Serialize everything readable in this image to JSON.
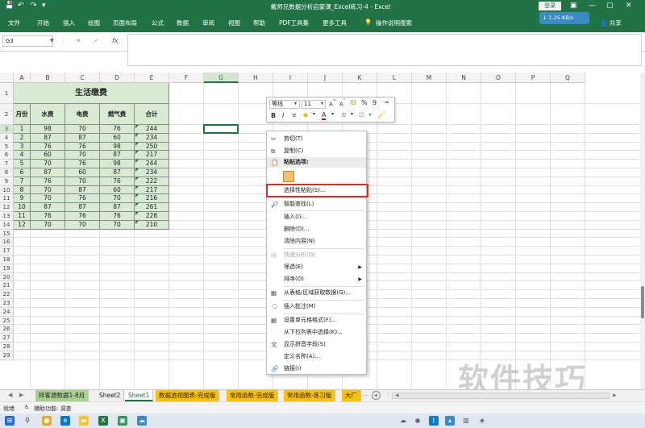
{
  "window": {
    "title": "戴师兄数据分析启蒙课_Excel练习-4  -  Excel",
    "login": "登录",
    "minimize": "—",
    "restore": "▢",
    "close": "✕"
  },
  "ribbon": {
    "tabs": [
      "文件",
      "开始",
      "插入",
      "绘图",
      "页面布局",
      "公式",
      "数据",
      "审阅",
      "视图",
      "帮助",
      "PDF工具集",
      "更多工具",
      "操作说明搜索"
    ],
    "share": "共享",
    "net_speed": "↓ 1.25 KB/s"
  },
  "formula_bar": {
    "name_box": "G3",
    "cancel": "✕",
    "enter": "✓",
    "fx": "fx",
    "value": ""
  },
  "columns": [
    "A",
    "B",
    "C",
    "D",
    "E",
    "F",
    "G",
    "H",
    "I",
    "J",
    "K",
    "L",
    "M",
    "N",
    "O",
    "P",
    "Q"
  ],
  "rows": [
    "1",
    "2",
    "3",
    "4",
    "5",
    "6",
    "7",
    "8",
    "9",
    "10",
    "11",
    "12",
    "13",
    "14",
    "15",
    "16",
    "17",
    "18",
    "19",
    "20",
    "21",
    "22",
    "23",
    "24",
    "25",
    "26",
    "27",
    "28",
    "29"
  ],
  "table": {
    "title": "生活缴费",
    "headers": [
      "月份",
      "水费",
      "电费",
      "燃气费",
      "合计"
    ],
    "data": [
      [
        "1",
        "98",
        "70",
        "76",
        "244"
      ],
      [
        "2",
        "87",
        "87",
        "60",
        "234"
      ],
      [
        "3",
        "76",
        "76",
        "98",
        "250"
      ],
      [
        "4",
        "60",
        "70",
        "87",
        "217"
      ],
      [
        "5",
        "70",
        "76",
        "98",
        "244"
      ],
      [
        "6",
        "87",
        "60",
        "87",
        "234"
      ],
      [
        "7",
        "76",
        "70",
        "76",
        "222"
      ],
      [
        "8",
        "70",
        "87",
        "60",
        "217"
      ],
      [
        "9",
        "70",
        "76",
        "70",
        "216"
      ],
      [
        "10",
        "87",
        "87",
        "87",
        "261"
      ],
      [
        "11",
        "76",
        "76",
        "76",
        "228"
      ],
      [
        "12",
        "70",
        "70",
        "70",
        "210"
      ]
    ]
  },
  "mini_toolbar": {
    "font": "等线",
    "size": "11",
    "bold": "B",
    "italic": "I",
    "percent": "%",
    "comma": "9"
  },
  "context_menu": {
    "cut": "剪切(T)",
    "copy": "复制(C)",
    "paste_options": "粘贴选项:",
    "paste_special": "选择性粘贴(S)...",
    "smart_lookup": "智能查找(L)",
    "insert": "插入(I)...",
    "delete": "删除(D)...",
    "clear": "清除内容(N)",
    "quick_analysis": "快速分析(Q)",
    "filter": "筛选(E)",
    "sort": "排序(O)",
    "from_table": "从表格/区域获取数据(G)...",
    "insert_comment": "插入批注(M)",
    "format_cells": "设置单元格格式(F)...",
    "pick_list": "从下拉列表中选择(K)...",
    "phonetic": "显示拼音字段(S)",
    "define_name": "定义名称(A)...",
    "link": "链接(I)"
  },
  "sheet_tabs": {
    "tabs": [
      "拌客源数据1-8月",
      "Sheet2",
      "Sheet1",
      "数据透视图表-完成版",
      "常用函数-完成版",
      "常用函数-练习版",
      "大厂"
    ],
    "active": "Sheet1",
    "add": "+"
  },
  "status": {
    "ready": "就绪",
    "accessibility": "辅助功能: 调查"
  },
  "watermark": "软件技巧",
  "colors": {
    "excel_green": "#217346",
    "table_fill": "#d9ead3",
    "highlight_red": "#d2322d"
  }
}
